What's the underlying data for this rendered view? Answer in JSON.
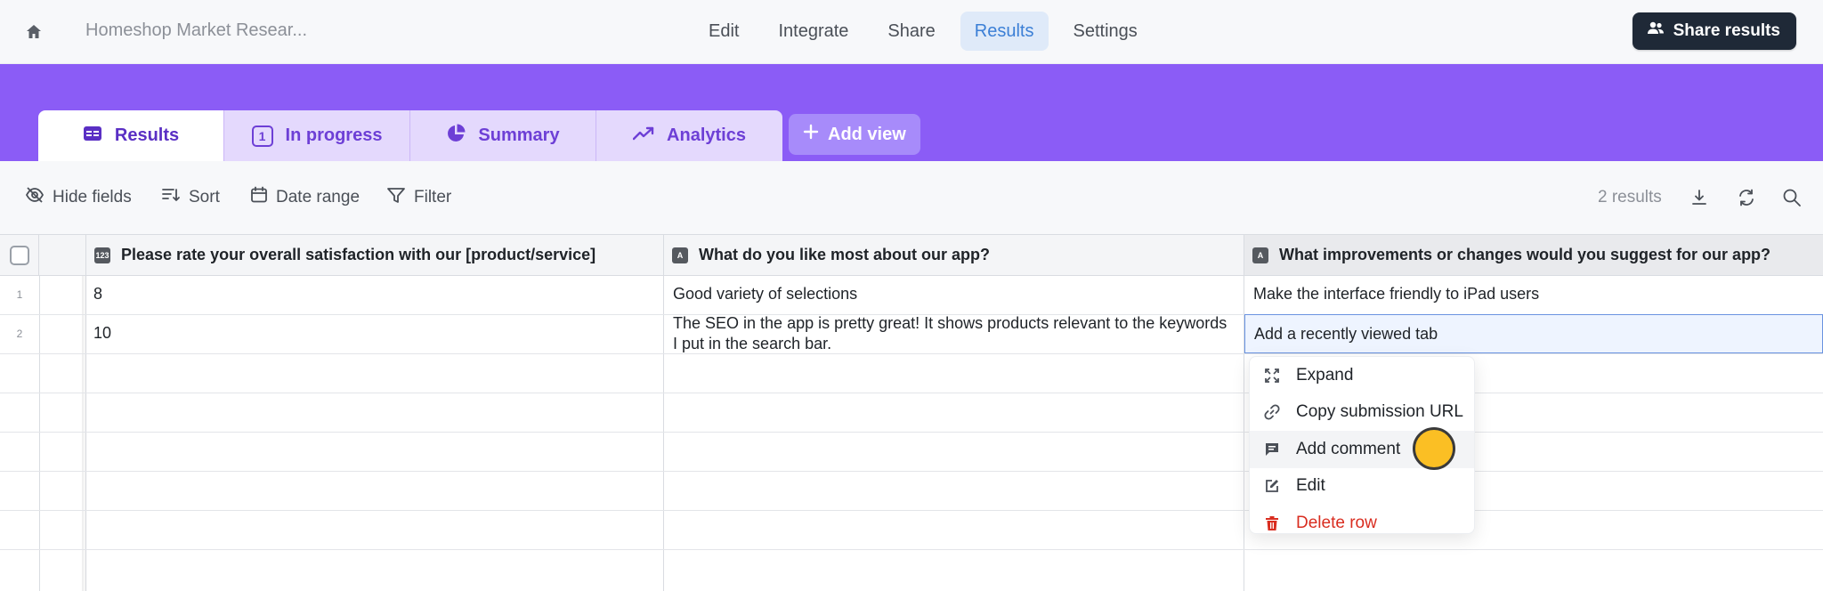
{
  "header": {
    "title": "Homeshop Market Resear...",
    "nav": [
      "Edit",
      "Integrate",
      "Share",
      "Results",
      "Settings"
    ],
    "active_nav": "Results",
    "share_button": "Share results"
  },
  "views": {
    "tabs": [
      {
        "label": "Results",
        "icon": "table-icon"
      },
      {
        "label": "In progress",
        "icon": "number-badge",
        "badge": "1"
      },
      {
        "label": "Summary",
        "icon": "pie-chart-icon"
      },
      {
        "label": "Analytics",
        "icon": "trending-up-icon"
      }
    ],
    "add_view": "Add view"
  },
  "toolbar": {
    "hide_fields": "Hide fields",
    "sort": "Sort",
    "date_range": "Date range",
    "filter": "Filter",
    "results_count": "2 results"
  },
  "table": {
    "columns": [
      "Please rate your overall satisfaction with our [product/service]",
      "What do you like most about our app?",
      "What improvements or changes would you suggest for our app?"
    ],
    "rows": [
      {
        "num": "1",
        "cells": [
          "8",
          "Good variety of selections",
          "Make the interface friendly to iPad users"
        ]
      },
      {
        "num": "2",
        "cells": [
          "10",
          "The SEO in the app is pretty great! It shows products relevant to the keywords I put in the search bar.",
          "Add a recently viewed tab"
        ]
      }
    ]
  },
  "context_menu": {
    "items": [
      "Expand",
      "Copy submission URL",
      "Add comment",
      "Edit",
      "Delete row"
    ]
  },
  "colors": {
    "banner": "#8b5cf6",
    "accent": "#3b7fd6",
    "danger": "#d92d20"
  }
}
